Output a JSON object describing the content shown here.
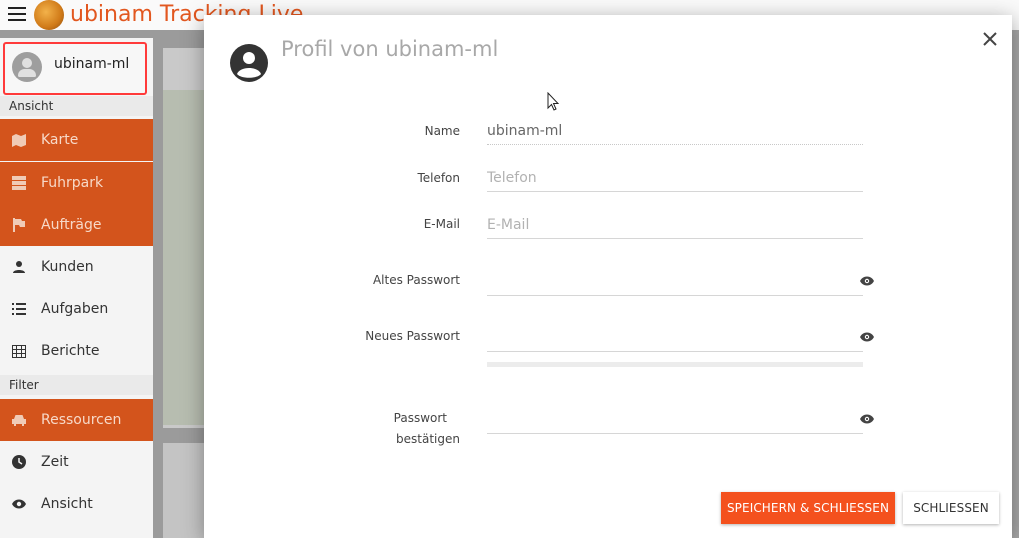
{
  "app": {
    "title": "ubinam Tracking Live"
  },
  "sidebar": {
    "user_name": "ubinam-ml",
    "section_view": "Ansicht",
    "section_filter": "Filter",
    "items": [
      {
        "label": "Karte",
        "icon": "map-icon",
        "active": true
      },
      {
        "label": "Fuhrpark",
        "icon": "storage-icon",
        "active": true
      },
      {
        "label": "Aufträge",
        "icon": "flag-icon",
        "active": true
      },
      {
        "label": "Kunden",
        "icon": "person-icon",
        "active": false
      },
      {
        "label": "Aufgaben",
        "icon": "list-icon",
        "active": false
      },
      {
        "label": "Berichte",
        "icon": "grid-icon",
        "active": false
      }
    ],
    "filter_items": [
      {
        "label": "Ressourcen",
        "icon": "car-icon",
        "active": true
      },
      {
        "label": "Zeit",
        "icon": "clock-icon",
        "active": false
      },
      {
        "label": "Ansicht",
        "icon": "eye-icon",
        "active": false
      }
    ]
  },
  "modal": {
    "title": "Profil von ubinam-ml",
    "fields": {
      "name": {
        "label": "Name",
        "value": "ubinam-ml"
      },
      "phone": {
        "label": "Telefon",
        "placeholder": "Telefon",
        "value": ""
      },
      "email": {
        "label": "E-Mail",
        "placeholder": "E-Mail",
        "value": ""
      },
      "old_password": {
        "label": "Altes Passwort",
        "value": ""
      },
      "new_password": {
        "label": "Neues Passwort",
        "value": ""
      },
      "confirm_password": {
        "label_line1": "Passwort",
        "label_line2": "bestätigen",
        "value": ""
      }
    },
    "password_strength": 0,
    "buttons": {
      "save": "SPEICHERN & SCHLIESSEN",
      "close": "SCHLIESSEN"
    }
  },
  "colors": {
    "accent": "#f4511e",
    "sidebar_active": "#d3541c",
    "highlight_border": "#ff3a3a"
  }
}
